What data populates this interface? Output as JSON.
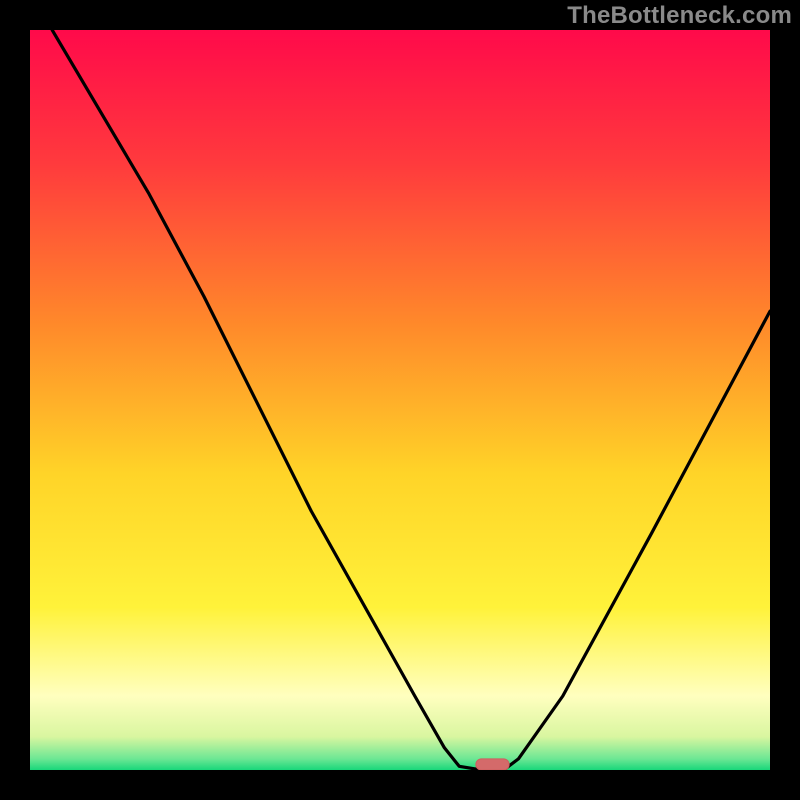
{
  "watermark": "TheBottleneck.com",
  "chart_data": {
    "type": "line",
    "title": "",
    "xlabel": "",
    "ylabel": "",
    "xlim": [
      0,
      100
    ],
    "ylim": [
      0,
      100
    ],
    "grid": false,
    "legend": false,
    "background": {
      "type": "vertical_gradient",
      "stops": [
        {
          "pos": 0.0,
          "color": "#ff0a4a"
        },
        {
          "pos": 0.18,
          "color": "#ff3a3d"
        },
        {
          "pos": 0.4,
          "color": "#ff8a2a"
        },
        {
          "pos": 0.6,
          "color": "#ffd428"
        },
        {
          "pos": 0.78,
          "color": "#fff23a"
        },
        {
          "pos": 0.9,
          "color": "#ffffbf"
        },
        {
          "pos": 0.955,
          "color": "#d9f6a0"
        },
        {
          "pos": 0.985,
          "color": "#6ce794"
        },
        {
          "pos": 1.0,
          "color": "#18d77a"
        }
      ]
    },
    "series": [
      {
        "name": "bottleneck-curve",
        "points": [
          {
            "x": 3.0,
            "y": 100.0
          },
          {
            "x": 16.0,
            "y": 78.0
          },
          {
            "x": 23.5,
            "y": 64.0
          },
          {
            "x": 38.0,
            "y": 35.0
          },
          {
            "x": 52.0,
            "y": 10.0
          },
          {
            "x": 56.0,
            "y": 3.0
          },
          {
            "x": 58.0,
            "y": 0.5
          },
          {
            "x": 61.0,
            "y": 0.0
          },
          {
            "x": 64.0,
            "y": 0.0
          },
          {
            "x": 66.0,
            "y": 1.5
          },
          {
            "x": 72.0,
            "y": 10.0
          },
          {
            "x": 84.0,
            "y": 32.0
          },
          {
            "x": 92.0,
            "y": 47.0
          },
          {
            "x": 100.0,
            "y": 62.0
          }
        ]
      }
    ],
    "marker": {
      "name": "optimum-marker",
      "x_center": 62.5,
      "y_center": 0.0,
      "width": 4.5,
      "height": 1.5,
      "color": "#d46a6a"
    }
  }
}
